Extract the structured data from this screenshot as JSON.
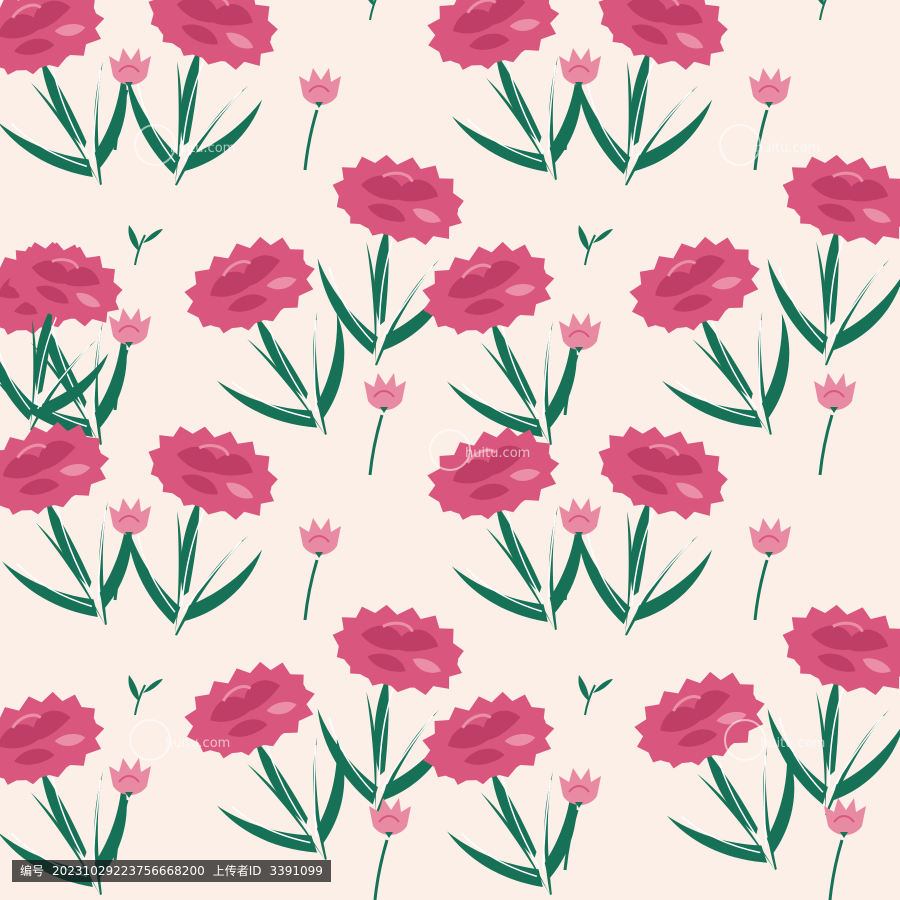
{
  "colors": {
    "background": "#FBEFE8",
    "petal_main": "#D9577F",
    "petal_dark": "#BE3E67",
    "petal_light": "#EB8EA8",
    "bud": "#E98AA3",
    "leaf": "#167156",
    "leaf_highlight": "#FFFFFF"
  },
  "pattern": {
    "subject": "carnation",
    "style": "seamless repeat"
  },
  "watermark": {
    "site_text": "huitu.com"
  },
  "info_bar": {
    "id_label": "编号",
    "id_value": "20231029223756668200",
    "uploader_label": "上传者ID",
    "uploader_value": "3391099"
  }
}
